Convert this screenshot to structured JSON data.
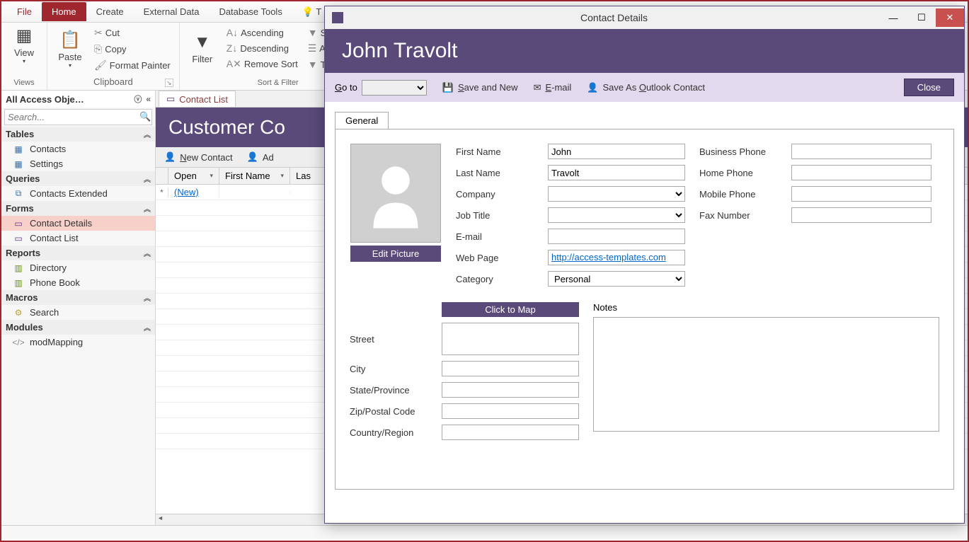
{
  "ribbon": {
    "tabs": {
      "file": "File",
      "home": "Home",
      "create": "Create",
      "external": "External Data",
      "tools": "Database Tools",
      "tell": "T"
    },
    "groups": {
      "views": {
        "view": "View",
        "label": "Views"
      },
      "clipboard": {
        "paste": "Paste",
        "cut": "Cut",
        "copy": "Copy",
        "painter": "Format Painter",
        "label": "Clipboard"
      },
      "sort": {
        "filter": "Filter",
        "asc": "Ascending",
        "desc": "Descending",
        "remove": "Remove Sort",
        "selection": "Selection",
        "advanced": "Advanced",
        "toggle": "Toggle Filte",
        "label": "Sort & Filter"
      }
    }
  },
  "nav": {
    "title": "All Access Obje…",
    "search_placeholder": "Search...",
    "sections": {
      "tables": "Tables",
      "queries": "Queries",
      "forms": "Forms",
      "reports": "Reports",
      "macros": "Macros",
      "modules": "Modules"
    },
    "items": {
      "contacts": "Contacts",
      "settings": "Settings",
      "contacts_ext": "Contacts Extended",
      "contact_details": "Contact Details",
      "contact_list": "Contact List",
      "directory": "Directory",
      "phone_book": "Phone Book",
      "search_macro": "Search",
      "modmapping": "modMapping"
    }
  },
  "doc": {
    "tab": "Contact List",
    "header": "Customer Co",
    "toolbar": {
      "new": "New Contact",
      "add": "Ad"
    },
    "cols": {
      "open": "Open",
      "first": "First Name",
      "last": "Las"
    },
    "newrow": "(New)"
  },
  "modal": {
    "title": "Contact Details",
    "name_header": "John Travolt",
    "toolbar": {
      "goto": "Go to",
      "save_new": "Save and New",
      "email": "E-mail",
      "outlook": "Save As Outlook Contact",
      "close": "Close"
    },
    "tab_general": "General",
    "labels": {
      "first": "First Name",
      "last": "Last Name",
      "company": "Company",
      "job": "Job Title",
      "email": "E-mail",
      "web": "Web Page",
      "category": "Category",
      "bphone": "Business Phone",
      "hphone": "Home Phone",
      "mphone": "Mobile Phone",
      "fax": "Fax Number",
      "street": "Street",
      "city": "City",
      "state": "State/Province",
      "zip": "Zip/Postal Code",
      "country": "Country/Region",
      "notes": "Notes"
    },
    "values": {
      "first": "John",
      "last": "Travolt",
      "company": "",
      "job": "",
      "email": "",
      "web": "http://access-templates.com",
      "category": "Personal",
      "bphone": "",
      "hphone": "",
      "mphone": "",
      "fax": "",
      "street": "",
      "city": "",
      "state": "",
      "zip": "",
      "country": "",
      "notes": ""
    },
    "editpic": "Edit Picture",
    "mapbtn": "Click to Map"
  }
}
